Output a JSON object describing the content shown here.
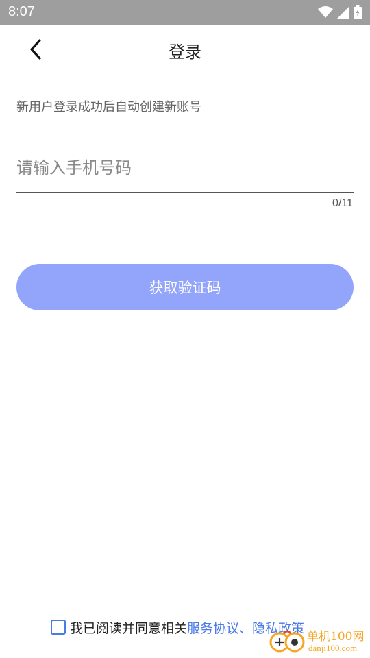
{
  "status_bar": {
    "time": "8:07",
    "icons": [
      "wifi-icon",
      "cell-signal-icon",
      "battery-icon"
    ]
  },
  "header": {
    "back_icon": "chevron-left-icon",
    "title": "登录"
  },
  "form": {
    "hint": "新用户登录成功后自动创建新账号",
    "phone_placeholder": "请输入手机号码",
    "phone_value": "",
    "counter": "0/11",
    "get_code_label": "获取验证码"
  },
  "agreement": {
    "checked": false,
    "prefix": "我已阅读并同意相关",
    "service_link": "服务协议",
    "separator": "、",
    "privacy_link": "隐私政策"
  },
  "watermark": {
    "brand": "单机100网",
    "domain": "danji100.com"
  },
  "colors": {
    "status_bar": "#9e9e9e",
    "button": "#93a5fb",
    "link": "#4a79e8",
    "watermark": "#f5a623"
  }
}
